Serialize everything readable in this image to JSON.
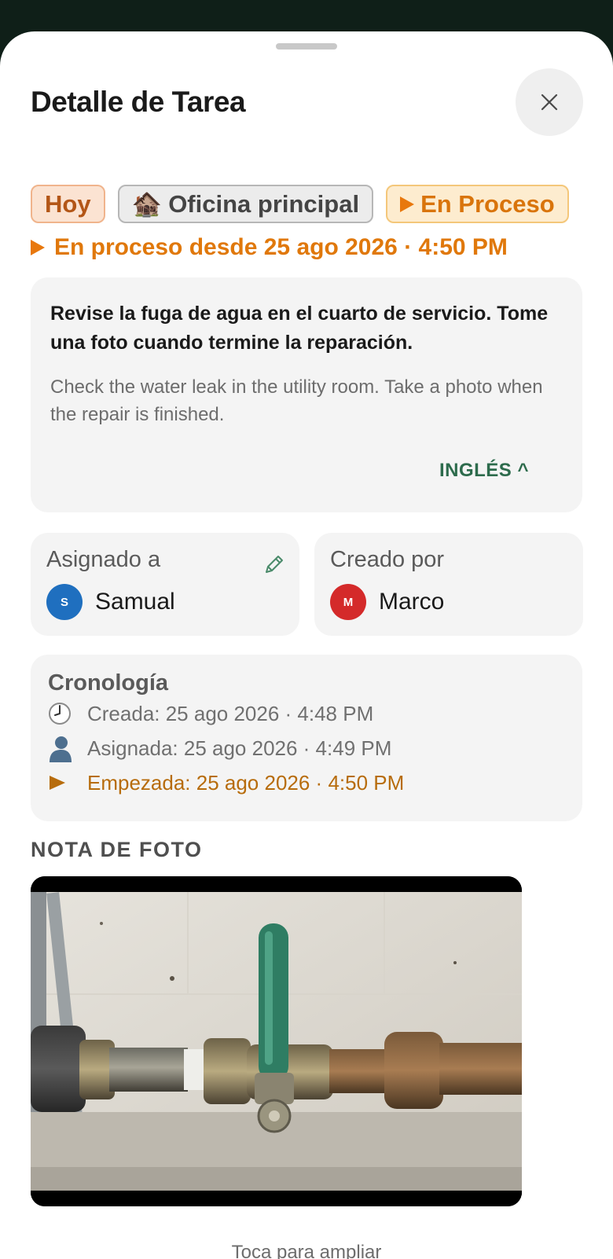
{
  "sheet": {
    "title": "Detalle de Tarea"
  },
  "chips": {
    "today": "Hoy",
    "location_emoji": "🏚️",
    "location": "Oficina principal",
    "status": "En Proceso"
  },
  "status_line": "En proceso desde 25 ago 2026 · 4:50 PM",
  "description": {
    "spanish": "Revise la fuga de agua en el cuarto de servicio. Tome una foto cuando termine la reparación.",
    "english": "Check the water leak in the utility room. Take a photo when the repair is finished.",
    "language_toggle": "INGLÉS ^"
  },
  "assigned": {
    "label": "Asignado a",
    "initial": "S",
    "name": "Samual",
    "avatar_color": "#1f6fbf"
  },
  "creator": {
    "label": "Creado por",
    "initial": "M",
    "name": "Marco",
    "avatar_color": "#d42a2a"
  },
  "timeline": {
    "title": "Cronología",
    "entries": [
      {
        "icon": "clock-icon",
        "text": "Creada: 25 ago 2026 · 4:48 PM"
      },
      {
        "icon": "person-icon",
        "text": "Asignada: 25 ago 2026 · 4:49 PM"
      },
      {
        "icon": "play-icon",
        "text": "Empezada: 25 ago 2026 · 4:50 PM"
      }
    ]
  },
  "photo": {
    "heading": "NOTA DE FOTO",
    "hint": "Toca para ampliar"
  },
  "colors": {
    "accent_orange": "#e0780b",
    "accent_green": "#2d6b4c",
    "backdrop": "#0f1f18"
  }
}
